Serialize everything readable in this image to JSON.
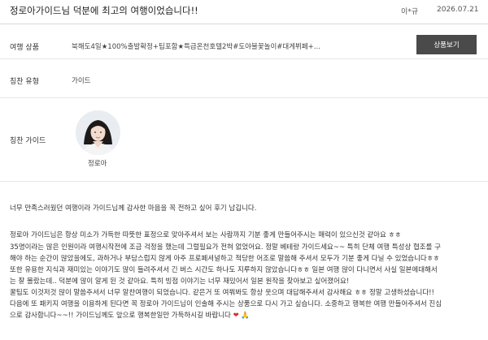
{
  "header": {
    "title": "정로아가이드님 덕분에 최고의 여행이었습니다!!",
    "author": "이*규",
    "date": "2026.07.21"
  },
  "info": {
    "product_label": "여행 상품",
    "product_value": "북해도4일★100%출발확정+팁포함★특급온천호텔2박#도야불꽃놀이#대게뷔페+...",
    "view_button": "상품보기",
    "praise_type_label": "칭찬 유형",
    "praise_type_value": "가이드",
    "praise_guide_label": "칭찬 가이드",
    "guide_name": "정로아"
  },
  "content": {
    "intro": "너무 만족스러웠던 여행이라 가이드님께 감사한 마음을 꼭 전하고 싶어 후기 남깁니다.",
    "lines": [
      "정로아 가이드님은 항상 미소가 가득한 따뜻한 표정으로 맞아주셔서 보는 사람까지 기분 좋게 만들어주시는 매력이 있으신것 같아요 ㅎㅎ",
      "35명이라는 많은 인원이라 여행시작전에 조금 걱정을 했는데 그럴필요가 전혀 없었어요. 정말 베테랑 가이드세요~~ 특히 단체 여행 특성상 협조를 구",
      "해야 하는 순간이 많았을에도, 과하거나 부담스럽지 않게 아주 프로페셔널하고 적당한 어조로 말씀해 주셔서 모두가 기분 좋게 다닐 수 있었습니다ㅎㅎ",
      "또한 유용한 지식과 재미있는 이야기도 많이 들려주셔서 긴 버스 시간도 하나도 지루하지 않았습니다ㅎㅎ 일본 여행 많이 다니면서 사실 일본에대해서",
      "는 잘 몰랐는데.. 덕분에 많이 알게 된 것 같아요. 특히 빙점 이야기는 너무 재밌어서 일본 원작을 찾아보고 싶어졌어요!",
      "꿀팁도 이것저것 많이 말씀주셔서 너무 알찬여행이 되었습니다. 같은거 또 여쭤봐도 항상 웃으며 대답해주셔서 감사해요 ㅎㅎ 정말 고생하셨습니다!!",
      "다음에 또 패키지 여행을 이용하게 된다면 꼭 정로아 가이드님이 인솔해 주시는 상품으로 다시 가고 싶습니다. 소중하고 행복한 여행 만들어주셔서 진심",
      "으로 감사합니다~~!! 가이드님께도 앞으로 행복한일만 가득하시길 바랍니다"
    ],
    "emoji_heart": "❤",
    "emoji_pray": "🙏"
  },
  "colors": {
    "button_bg": "#4a4a4a",
    "divider": "#e6e6e6",
    "heart": "#d32f2f"
  }
}
